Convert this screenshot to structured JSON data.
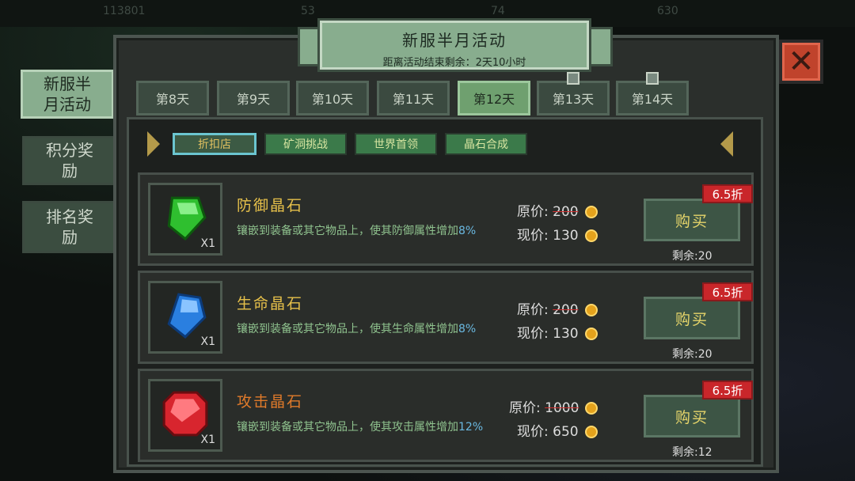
{
  "top_bar": {
    "gold": "113801",
    "a": "53",
    "b": "74",
    "c": "630"
  },
  "title": {
    "main": "新服半月活动",
    "sub": "距离活动结束剩余：2天10小时"
  },
  "side_tabs": [
    {
      "label": "新服半\n月活动",
      "active": true
    },
    {
      "label": "积分奖\n励",
      "active": false
    },
    {
      "label": "排名奖\n励",
      "active": false
    }
  ],
  "day_tabs": [
    {
      "label": "第8天",
      "active": false,
      "locked": false
    },
    {
      "label": "第9天",
      "active": false,
      "locked": false
    },
    {
      "label": "第10天",
      "active": false,
      "locked": false
    },
    {
      "label": "第11天",
      "active": false,
      "locked": false
    },
    {
      "label": "第12天",
      "active": true,
      "locked": false
    },
    {
      "label": "第13天",
      "active": false,
      "locked": true
    },
    {
      "label": "第14天",
      "active": false,
      "locked": true
    }
  ],
  "categories": [
    {
      "label": "折扣店",
      "active": true
    },
    {
      "label": "矿洞挑战",
      "active": false
    },
    {
      "label": "世界首领",
      "active": false
    },
    {
      "label": "晶石合成",
      "active": false
    }
  ],
  "labels": {
    "orig": "原价:",
    "now": "现价:",
    "buy": "购买",
    "remain": "剩余:"
  },
  "items": [
    {
      "name": "防御晶石",
      "name_color": "#e6c04a",
      "desc": "镶嵌到装备或其它物品上，使其防御属性增加",
      "pct": "8%",
      "qty": "X1",
      "gem": "green",
      "orig_price": "200",
      "now_price": "130",
      "discount": "6.5折",
      "remain": "20"
    },
    {
      "name": "生命晶石",
      "name_color": "#e6c04a",
      "desc": "镶嵌到装备或其它物品上，使其生命属性增加",
      "pct": "8%",
      "qty": "X1",
      "gem": "blue",
      "orig_price": "200",
      "now_price": "130",
      "discount": "6.5折",
      "remain": "20"
    },
    {
      "name": "攻击晶石",
      "name_color": "#e07a2a",
      "desc": "镶嵌到装备或其它物品上，使其攻击属性增加",
      "pct": "12%",
      "qty": "X1",
      "gem": "red",
      "orig_price": "1000",
      "now_price": "650",
      "discount": "6.5折",
      "remain": "12"
    }
  ]
}
